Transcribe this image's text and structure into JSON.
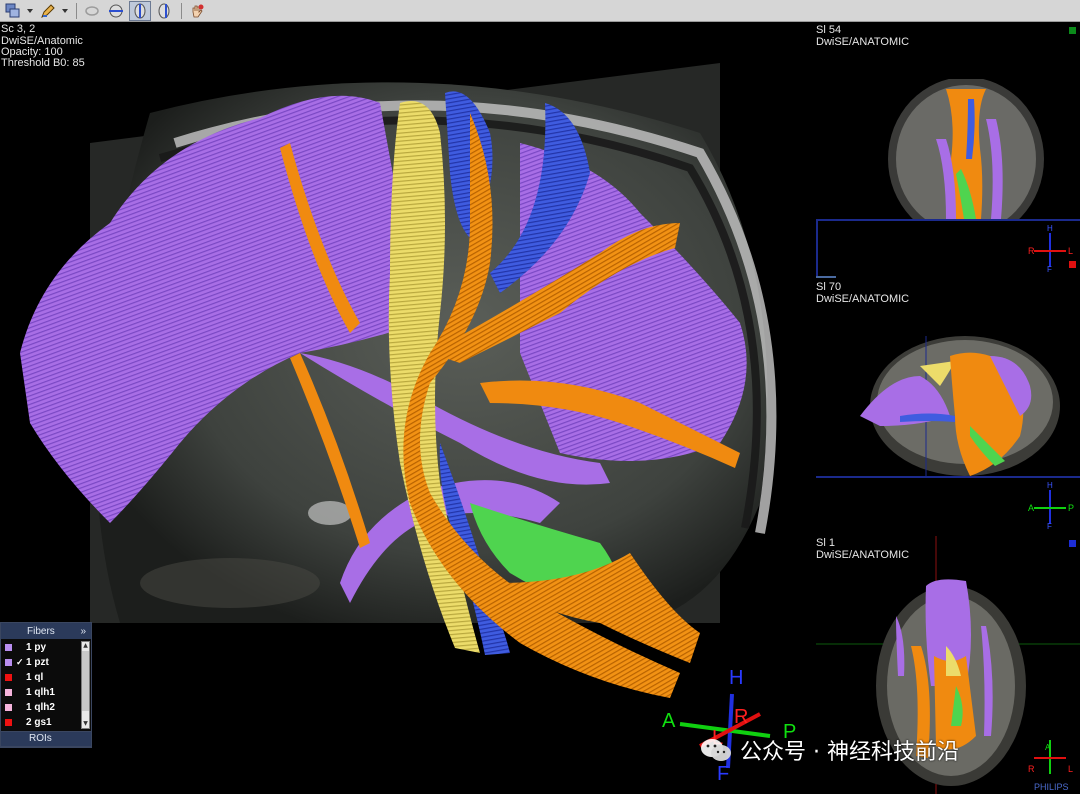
{
  "toolbar": {
    "tools": [
      {
        "name": "layout-tool",
        "icon": "layout-icon"
      },
      {
        "name": "annotate-tool",
        "icon": "pen-icon"
      },
      {
        "name": "rotate-tool",
        "icon": "rotate-icon"
      },
      {
        "name": "slice-axial-tool",
        "icon": "slice-axial-icon"
      },
      {
        "name": "slice-sagittal-tool",
        "icon": "slice-sagittal-icon"
      },
      {
        "name": "slice-coronal-tool",
        "icon": "slice-coronal-icon"
      },
      {
        "name": "hand-tool",
        "icon": "hand-icon"
      }
    ]
  },
  "main": {
    "info_lines": [
      "Sc 3, 2",
      "DwiSE/Anatomic",
      "Opacity: 100",
      "Threshold B0: 85"
    ],
    "orientation": {
      "h": "H",
      "r": "R",
      "a": "A",
      "p": "P",
      "l": "L",
      "f": "F"
    }
  },
  "views": [
    {
      "slice": "Sl 54",
      "series": "DwiSE/ANATOMIC",
      "marker_color": "#0b8a1a",
      "orient": {
        "h": "H",
        "r": "R",
        "l": "L",
        "f": "F"
      }
    },
    {
      "slice": "Sl 70",
      "series": "DwiSE/ANATOMIC",
      "marker_color": "#e01010",
      "orient": {
        "h": "H",
        "a": "A",
        "p": "P",
        "f": "F"
      }
    },
    {
      "slice": "Sl 1",
      "series": "DwiSE/ANATOMIC",
      "marker_color": "#1d2dd6",
      "orient": {
        "a": "A",
        "r": "R",
        "l": "L"
      }
    }
  ],
  "fibers": {
    "title": "Fibers",
    "expand": "»",
    "items": [
      {
        "label": "1 py",
        "color": "#b98ef0",
        "checked": false
      },
      {
        "label": "1 pzt",
        "color": "#b98ef0",
        "checked": true
      },
      {
        "label": "1 ql",
        "color": "#ee1111",
        "checked": false
      },
      {
        "label": "1 qlh1",
        "color": "#f5b3dc",
        "checked": false
      },
      {
        "label": "1 qlh2",
        "color": "#f5b3dc",
        "checked": false
      },
      {
        "label": "2 gs1",
        "color": "#ee1111",
        "checked": false
      }
    ],
    "rois_label": "ROIs"
  },
  "watermark": {
    "text": "公众号 · 神经科技前沿"
  },
  "brand": "PHILIPS",
  "colors": {
    "purple": "#a76ee0",
    "yellow": "#eede6a",
    "orange": "#f08a10",
    "blue": "#3a55d8",
    "green": "#4ed24e"
  }
}
